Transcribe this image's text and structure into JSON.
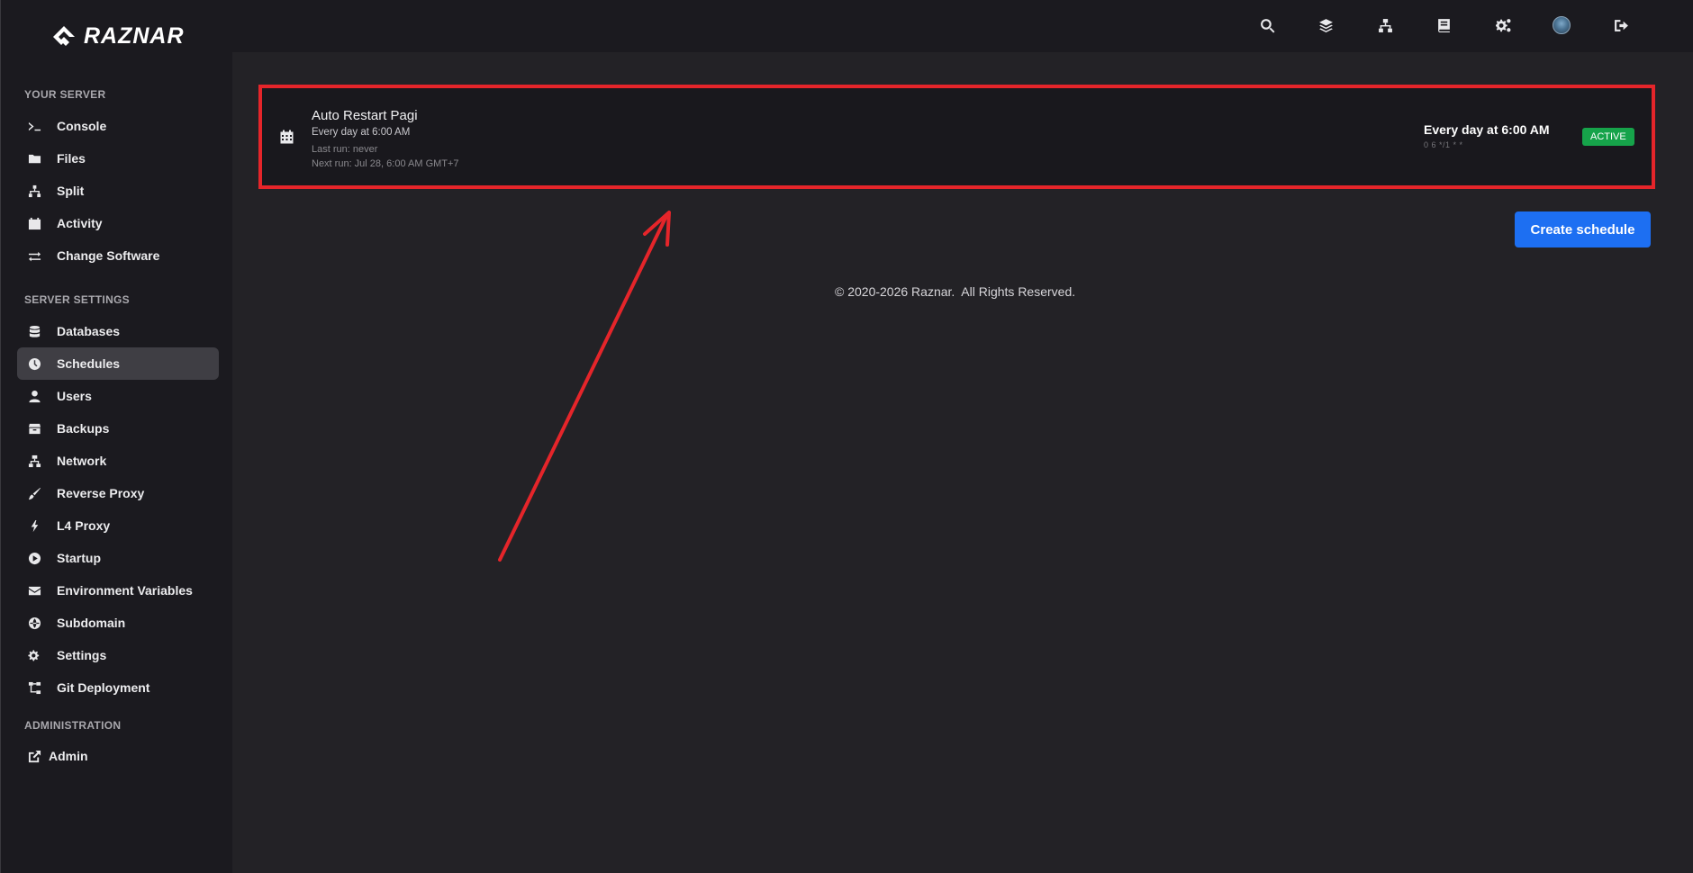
{
  "app": {
    "name": "RAZNAR"
  },
  "sidebar": {
    "sections": [
      {
        "title": "YOUR SERVER"
      },
      {
        "title": "SERVER SETTINGS"
      },
      {
        "title": "ADMINISTRATION"
      }
    ],
    "items": [
      {
        "label": "Console",
        "icon": "terminal-icon"
      },
      {
        "label": "Files",
        "icon": "folder-icon"
      },
      {
        "label": "Split",
        "icon": "sitemap-icon"
      },
      {
        "label": "Activity",
        "icon": "calendar-icon"
      },
      {
        "label": "Change Software",
        "icon": "exchange-icon"
      },
      {
        "label": "Databases",
        "icon": "database-icon"
      },
      {
        "label": "Schedules",
        "icon": "clock-icon",
        "active": true
      },
      {
        "label": "Users",
        "icon": "user-icon"
      },
      {
        "label": "Backups",
        "icon": "archive-icon"
      },
      {
        "label": "Network",
        "icon": "network-icon"
      },
      {
        "label": "Reverse Proxy",
        "icon": "brush-icon"
      },
      {
        "label": "L4 Proxy",
        "icon": "bolt-icon"
      },
      {
        "label": "Startup",
        "icon": "play-circle-icon"
      },
      {
        "label": "Environment Variables",
        "icon": "envelope-icon"
      },
      {
        "label": "Subdomain",
        "icon": "globe-icon"
      },
      {
        "label": "Settings",
        "icon": "cogs-icon"
      },
      {
        "label": "Git Deployment",
        "icon": "git-branch-icon"
      },
      {
        "label": "Admin",
        "icon": "external-link-icon"
      }
    ]
  },
  "topbar": {
    "icons": [
      "search-icon",
      "layers-icon",
      "sitemap-icon",
      "book-icon",
      "cogs-icon",
      "avatar-icon",
      "sign-out-icon"
    ]
  },
  "schedule": {
    "name": "Auto Restart Pagi",
    "summary": "Every day at 6:00 AM",
    "last_run": "Last run: never",
    "next_run": "Next run: Jul 28, 6:00 AM GMT+7",
    "schedule_label": "Every day at 6:00 AM",
    "cron": "0 6 */1 * *",
    "status": "ACTIVE"
  },
  "actions": {
    "create_label": "Create schedule"
  },
  "footer": {
    "prefix": "© 2020-2026 ",
    "brand": "Raznar",
    "suffix": ".  All Rights Reserved."
  },
  "colors": {
    "accent": "#1d6ff2",
    "active_badge": "#16a34a",
    "annotation": "#e5252a"
  }
}
